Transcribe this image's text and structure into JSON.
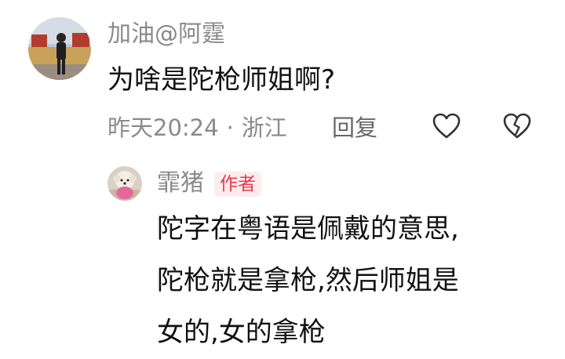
{
  "comment": {
    "avatar_icon": "user-photo-avatar",
    "username": "加油@阿霆",
    "text": "为啥是陀枪师姐啊?",
    "time": "昨天20:24",
    "separator": "·",
    "location": "浙江",
    "reply_label": "回复",
    "like_icon": "heart-outline-icon",
    "dislike_icon": "broken-heart-icon"
  },
  "reply": {
    "avatar_icon": "dog-photo-avatar",
    "username": "霏猪",
    "badge": "作者",
    "badge_color": "#f0384a",
    "lines": [
      "陀字在粤语是佩戴的意思,",
      "陀枪就是拿枪,然后师姐是",
      "女的,女的拿枪"
    ]
  },
  "colors": {
    "meta_text": "#8a8a8a",
    "body_text": "#111111",
    "icon_stroke": "#333333"
  }
}
